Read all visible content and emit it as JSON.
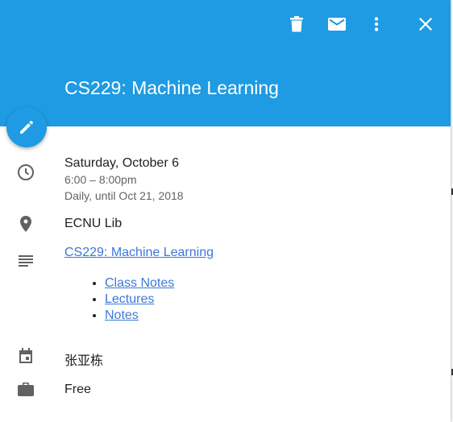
{
  "event": {
    "title": "CS229: Machine Learning",
    "date": "Saturday, October 6",
    "time": "6:00 – 8:00pm",
    "recurrence": "Daily, until Oct 21, 2018",
    "location": "ECNU Lib",
    "description_link": "CS229: Machine Learning",
    "description_items": [
      "Class Notes",
      "Lectures",
      "Notes"
    ],
    "calendar_owner": "张亚栋",
    "availability": "Free"
  },
  "colors": {
    "header": "#1e9be2",
    "link": "#3c78d8",
    "icon": "#616161"
  },
  "icons": {
    "toolbar": [
      "delete-icon",
      "email-icon",
      "more-vert-icon",
      "close-icon"
    ],
    "fab": "edit-pencil-icon",
    "rows": [
      "clock-icon",
      "location-pin-icon",
      "description-lines-icon",
      "calendar-icon",
      "briefcase-icon"
    ]
  }
}
